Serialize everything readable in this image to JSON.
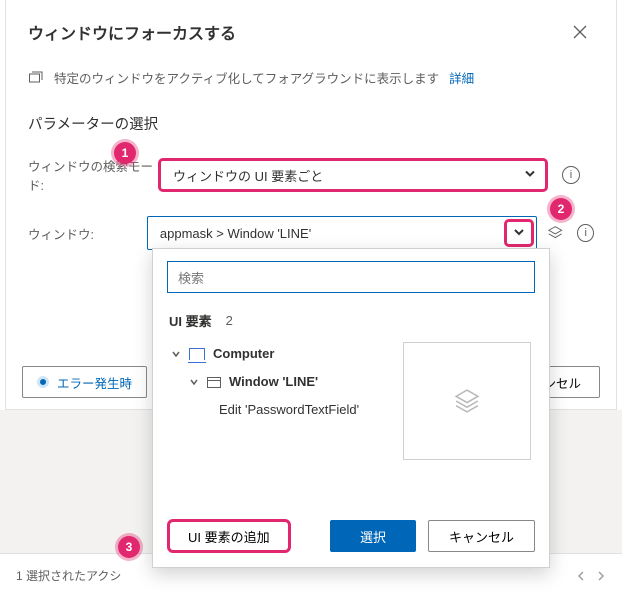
{
  "dialog": {
    "title": "ウィンドウにフォーカスする",
    "description": "特定のウィンドウをアクティブ化してフォアグラウンドに表示します",
    "details_link": "詳細",
    "section_title": "パラメーターの選択",
    "search_mode_label": "ウィンドウの検索モード:",
    "search_mode_value": "ウィンドウの UI 要素ごと",
    "window_label": "ウィンドウ:",
    "window_value": "appmask > Window 'LINE'",
    "error_button": "エラー発生時",
    "cancel_top": "キャンセル"
  },
  "popover": {
    "search_placeholder": "検索",
    "header_label": "UI 要素",
    "count": "2",
    "tree": {
      "root": "Computer",
      "window": "Window 'LINE'",
      "leaf": "Edit 'PasswordTextField'"
    },
    "add_button": "UI 要素の追加",
    "select_button": "選択",
    "cancel_button": "キャンセル"
  },
  "bottombar": {
    "status": "1 選択されたアクシ"
  },
  "callouts": {
    "one": "1",
    "two": "2",
    "three": "3"
  }
}
